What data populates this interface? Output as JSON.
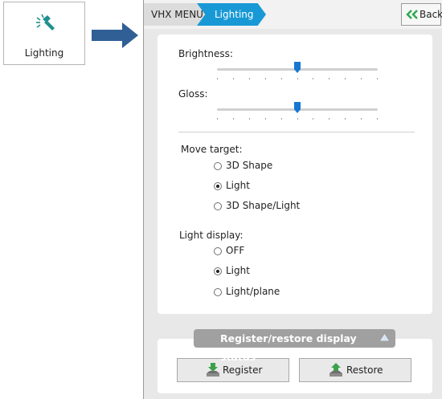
{
  "tile": {
    "icon": "flashlight-icon",
    "label": "Lighting"
  },
  "nav_arrow": {
    "icon": "arrow-right-icon"
  },
  "breadcrumb": {
    "home": "VHX MENU",
    "current": "Lighting"
  },
  "back_button": {
    "label": "Back",
    "icon": "double-chevron-left-icon"
  },
  "brightness": {
    "label": "Brightness:",
    "level": 0.5,
    "ticks": 10
  },
  "gloss": {
    "label": "Gloss:",
    "level": 0.5,
    "ticks": 10
  },
  "move_target": {
    "label": "Move target:",
    "options": [
      "3D Shape",
      "Light",
      "3D Shape/Light"
    ],
    "selected": "Light"
  },
  "light_display": {
    "label": "Light display:",
    "options": [
      "OFF",
      "Light",
      "Light/plane"
    ],
    "selected": "Light"
  },
  "register_restore": {
    "header": "Register/restore display status",
    "register_label": "Register",
    "restore_label": "Restore"
  },
  "colors": {
    "accent": "#1899d6",
    "slider_thumb": "#1677d2",
    "back_chevron": "#2ea84f",
    "arrow": "#2f5f95"
  }
}
